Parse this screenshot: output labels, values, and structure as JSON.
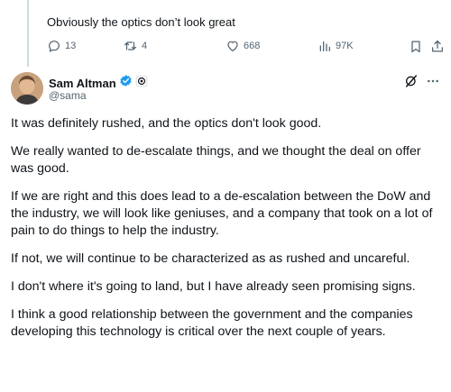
{
  "quoted_reply": {
    "text": "Obviously the optics don’t look great"
  },
  "actions": {
    "replies": "13",
    "reposts": "4",
    "likes": "668",
    "views": "97K",
    "accent_color": "#536471"
  },
  "post": {
    "author": {
      "display_name": "Sam Altman",
      "handle": "@sama",
      "verified_color": "#1d9bf0"
    },
    "icons": [
      "grok-icon",
      "more-icon"
    ],
    "paragraphs": [
      "It was definitely rushed, and the optics don't look good.",
      "We really wanted to de-escalate things, and we thought the deal on offer was good.",
      "If we are right and this does lead to a de-escalation between the DoW and the industry, we will look like geniuses, and a company that took on a lot of pain to do things to help the industry.",
      "If not, we will continue to be characterized as as rushed and uncareful.",
      "I don't where it's going to land, but I have already seen promising signs.",
      "I think a good relationship between the government and the companies developing this technology is critical over the next couple of years."
    ]
  }
}
